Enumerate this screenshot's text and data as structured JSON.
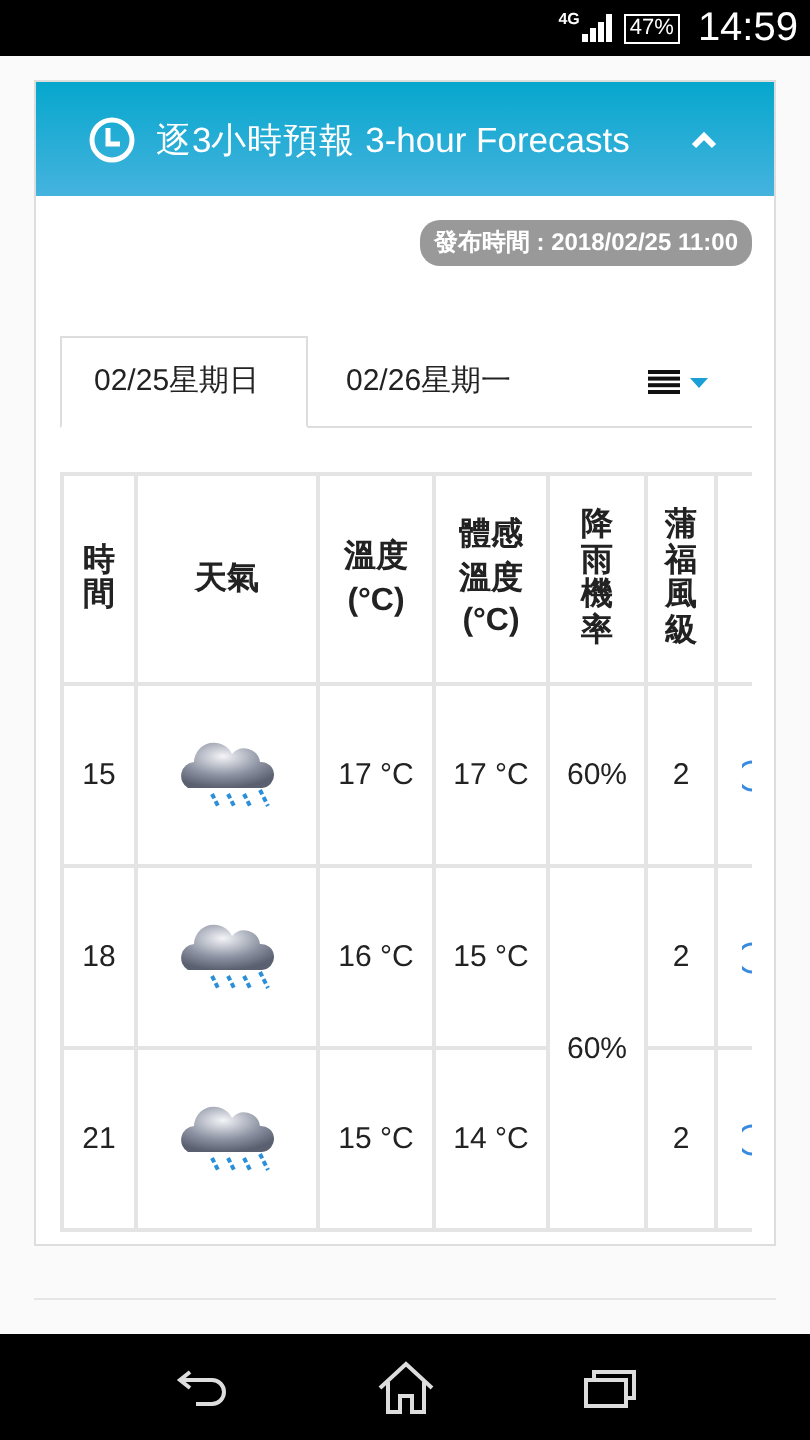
{
  "status_bar": {
    "network": "4G",
    "battery": "47%",
    "time": "14:59"
  },
  "panel": {
    "title": "逐3小時預報 3-hour Forecasts",
    "expanded": true,
    "issued": "發布時間 : 2018/02/25 11:00"
  },
  "tabs": [
    {
      "label": "02/25星期日",
      "selected": true
    },
    {
      "label": "02/26星期一",
      "selected": false
    }
  ],
  "table": {
    "columns": [
      {
        "label": "時間",
        "vertical": true
      },
      {
        "label": "天氣",
        "vertical": false
      },
      {
        "label": "溫度(°C)",
        "vertical": false
      },
      {
        "label": "體感溫度(°C)",
        "vertical": false
      },
      {
        "label": "降雨機率",
        "vertical": true
      },
      {
        "label": "蒲福風級",
        "vertical": true
      }
    ],
    "rows": [
      {
        "time": "15",
        "temp": "17 °C",
        "feels": "17 °C",
        "rain": "60%",
        "rain_merged_with_next": false,
        "wind": "2"
      },
      {
        "time": "18",
        "temp": "16 °C",
        "feels": "15 °C",
        "rain": "60%",
        "rain_merged_with_next": true,
        "wind": "2"
      },
      {
        "time": "21",
        "temp": "15 °C",
        "feels": "14 °C",
        "wind": "2"
      }
    ]
  }
}
